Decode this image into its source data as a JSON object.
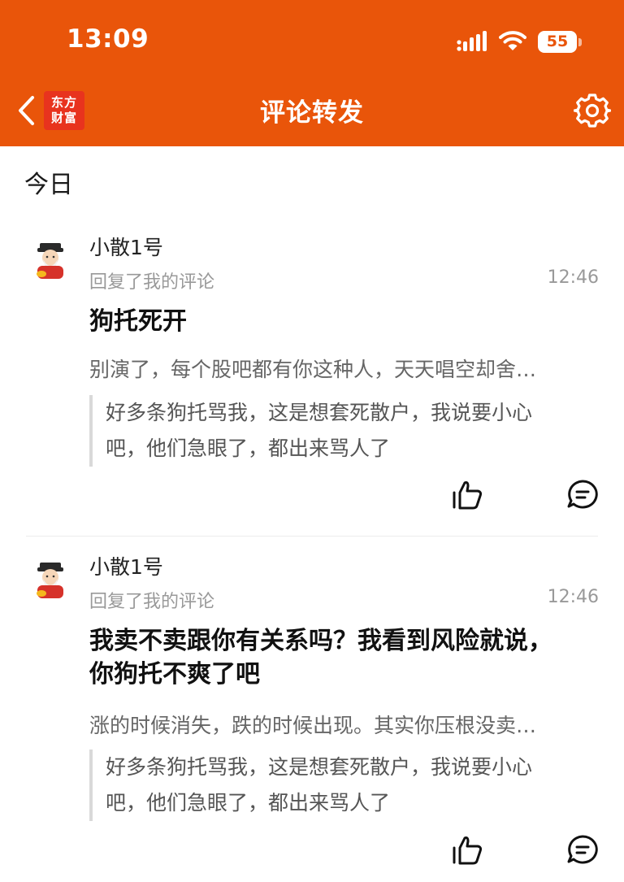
{
  "status_bar": {
    "time": "13:09",
    "battery": "55"
  },
  "header": {
    "logo_line1": "东方",
    "logo_line2": "财富",
    "title": "评论转发"
  },
  "section_label": "今日",
  "notifications": [
    {
      "username": "小散1号",
      "action": "回复了我的评论",
      "time": "12:46",
      "title": "狗托死开",
      "preview": "别演了，每个股吧都有你这种人，天天唱空却舍…",
      "quote_line1": "好多条狗托骂我，这是想套死散户，我说要小心",
      "quote_line2": "吧，他们急眼了，都出来骂人了"
    },
    {
      "username": "小散1号",
      "action": "回复了我的评论",
      "time": "12:46",
      "title_line1": "我卖不卖跟你有关系吗？我看到风险就说，",
      "title_line2": "你狗托不爽了吧",
      "preview": "涨的时候消失，跌的时候出现。其实你压根没卖…",
      "quote_line1": "好多条狗托骂我，这是想套死散户，我说要小心",
      "quote_line2": "吧，他们急眼了，都出来骂人了"
    }
  ],
  "icons": {
    "back": "chevron-left-icon",
    "settings": "gear-icon",
    "like": "thumbs-up-icon",
    "reply": "comment-bubble-icon",
    "avatar": "fortune-god-avatar"
  },
  "colors": {
    "header_bg": "#E9550A",
    "logo_bg": "#E8331E",
    "secondary_text": "#999999"
  }
}
